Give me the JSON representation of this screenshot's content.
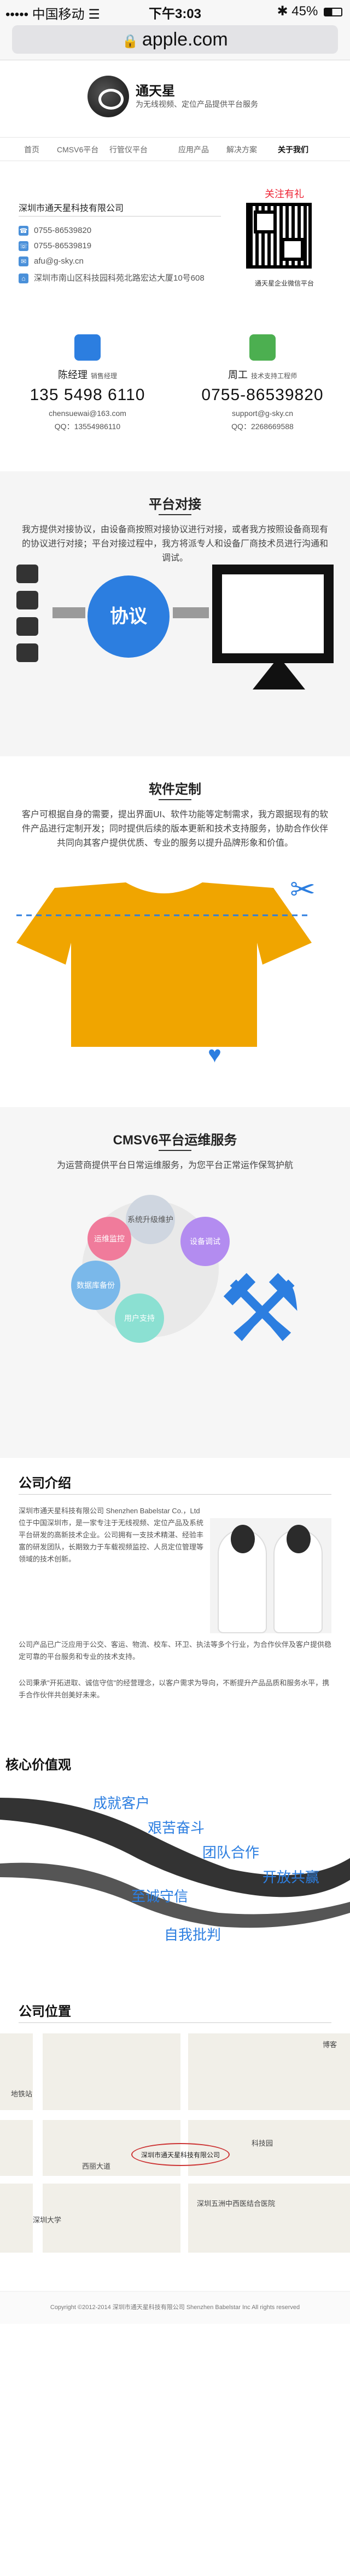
{
  "status_bar": {
    "carrier": "••••• 中国移动 ☰",
    "time": "下午3:03",
    "battery": "45%"
  },
  "url_bar": {
    "url": "apple.com"
  },
  "header": {
    "brand": "通天星",
    "slogan": "为无线视频、定位产品提供平台服务"
  },
  "nav": {
    "items": [
      "首页",
      "CMSV6平台",
      "行管仪平台",
      "应用产品",
      "解决方案",
      "关于我们"
    ],
    "active_index": 5
  },
  "contact": {
    "company": "深圳市通天星科技有限公司",
    "phone1": "0755-86539820",
    "phone2": "0755-86539819",
    "email": "afu@g-sky.cn",
    "address": "深圳市南山区科技园科苑北路宏达大厦10号608",
    "follow_label": "关注有礼",
    "qr_caption": "通天星企业微信平台",
    "people": [
      {
        "name": "陈经理",
        "title": "销售经理",
        "phone": "135 5498 6110",
        "email": "chensuewai@163.com",
        "qq": "QQ：13554986110",
        "color": "#2c7ee0"
      },
      {
        "name": "周工",
        "title": "技术支持工程师",
        "phone": "0755-86539820",
        "email": "support@g-sky.cn",
        "qq": "QQ：2268669588",
        "color": "#4caf50"
      }
    ]
  },
  "dock": {
    "title": "平台对接",
    "desc": "我方提供对接协议，由设备商按照对接协议进行对接，或者我方按照设备商现有的协议进行对接；平台对接过程中，我方将派专人和设备厂商技术员进行沟通和调试。",
    "protocol_label": "协议"
  },
  "custom": {
    "title": "软件定制",
    "desc": "客户可根据自身的需要，提出界面UI、软件功能等定制需求，我方跟据现有的软件产品进行定制开发；同时提供后续的版本更新和技术支持服务，协助合作伙伴共同向其客户提供优质、专业的服务以提升品牌形象和价值。",
    "accent": "#f0a500"
  },
  "cmsv6": {
    "title": "CMSV6平台运维服务",
    "desc": "为运营商提供平台日常运维服务，为您平台正常运作保驾护航",
    "bubbles": [
      "系统升级维护",
      "设备调试",
      "数据库备份",
      "运维监控",
      "用户支持"
    ]
  },
  "intro": {
    "title": "公司介绍",
    "para1": "深圳市通天星科技有限公司 Shenzhen Babelstar Co.，Ltd 位于中国深圳市，是一家专注于无线视频、定位产品及系统平台研发的高新技术企业。公司拥有一支技术精湛、经验丰富的研发团队，长期致力于车载视频监控、人员定位管理等领域的技术创新。",
    "para2": "公司产品已广泛应用于公交、客运、物流、校车、环卫、执法等多个行业，为合作伙伴及客户提供稳定可靠的平台服务和专业的技术支持。",
    "para3": "公司秉承\"开拓进取、诚信守信\"的经营理念，以客户需求为导向，不断提升产品品质和服务水平，携手合作伙伴共创美好未来。"
  },
  "values": {
    "title": "核心价值观",
    "items": [
      "成就客户",
      "艰苦奋斗",
      "团队合作",
      "开放共赢",
      "至诚守信",
      "自我批判"
    ]
  },
  "location": {
    "title": "公司位置",
    "labels": [
      "博客",
      "科技园",
      "深圳市通天星科技有限公司",
      "地铁站",
      "西丽大道",
      "深圳五洲中西医结合医院",
      "深圳大学"
    ]
  },
  "footer": {
    "text": "Copyright ©2012-2014 深圳市通天星科技有限公司 Shenzhen Babelstar Inc All rights reserved"
  }
}
